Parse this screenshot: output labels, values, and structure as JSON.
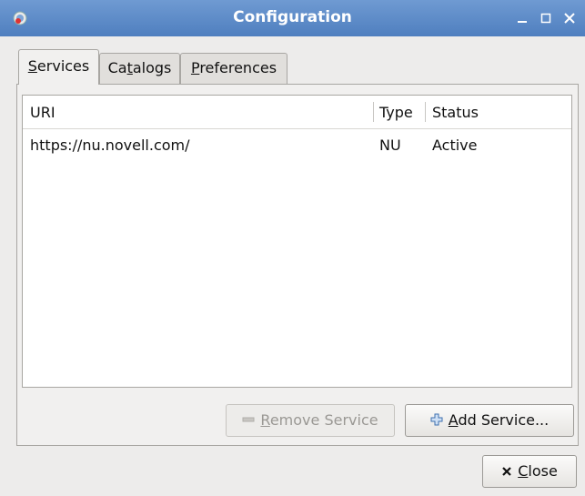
{
  "window": {
    "title": "Configuration",
    "icon": "gear-globe-icon"
  },
  "tabs": [
    {
      "label": "Services",
      "mnemonic": "S",
      "active": true
    },
    {
      "label": "Catalogs",
      "mnemonic": "t",
      "active": false
    },
    {
      "label": "Preferences",
      "mnemonic": "P",
      "active": false
    }
  ],
  "table": {
    "columns": [
      "URI",
      "Type",
      "Status"
    ],
    "rows": [
      {
        "uri": "https://nu.novell.com/",
        "type": "NU",
        "status": "Active"
      }
    ]
  },
  "buttons": {
    "remove_service": "Remove Service",
    "add_service": "Add Service...",
    "close": "Close"
  },
  "colors": {
    "titlebar": "#5d8bc8",
    "window_bg": "#edeceb"
  }
}
